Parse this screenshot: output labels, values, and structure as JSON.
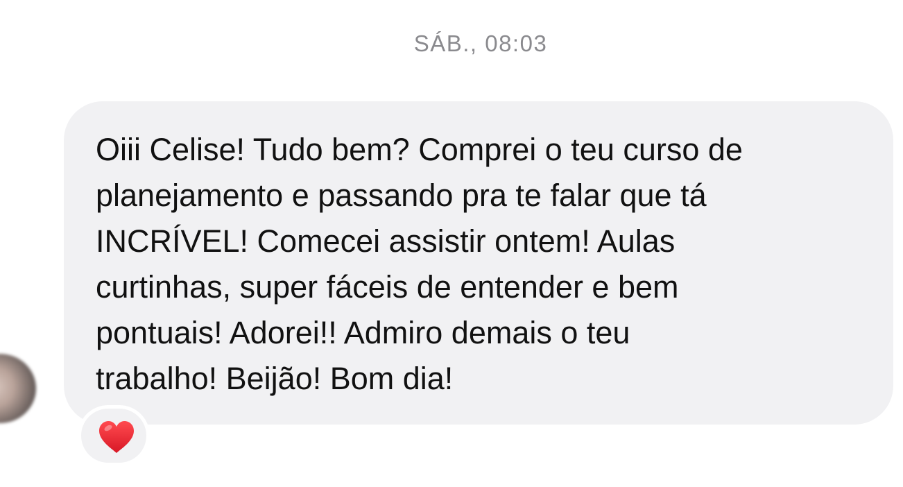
{
  "chat": {
    "timestamp": "SÁB., 08:03",
    "message": {
      "lines": [
        "Oiii Celise! Tudo bem? Comprei o teu curso de",
        "planejamento e passando pra te falar que tá",
        "INCRÍVEL! Comecei assistir ontem! Aulas",
        "curtinhas, super fáceis de entender e bem",
        "pontuais! Adorei!! Admiro demais o teu",
        "trabalho! Beijão! Bom dia!"
      ],
      "reaction": "heart-icon"
    },
    "colors": {
      "bubble": "#f1f1f3",
      "timestamp": "#8a8a8e",
      "text": "#111111",
      "heart": "#e0202e"
    }
  }
}
